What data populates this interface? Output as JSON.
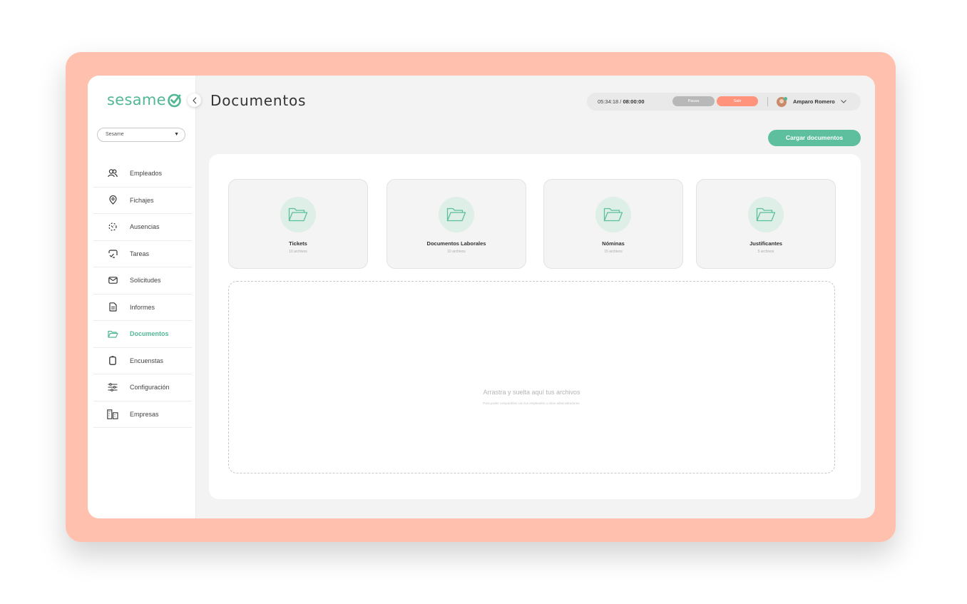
{
  "app": {
    "logo_text": "sesame",
    "brand_color": "#52b894",
    "frame_color": "#ffc0ad"
  },
  "sidebar": {
    "company_select": {
      "value": "Sesame"
    },
    "items": [
      {
        "label": "Empleados",
        "icon": "users-icon",
        "active": false
      },
      {
        "label": "Fichajes",
        "icon": "location-pin-icon",
        "active": false
      },
      {
        "label": "Ausencias",
        "icon": "absence-icon",
        "active": false
      },
      {
        "label": "Tareas",
        "icon": "tasks-icon",
        "active": false
      },
      {
        "label": "Solicitudes",
        "icon": "envelope-icon",
        "active": false
      },
      {
        "label": "Informes",
        "icon": "document-icon",
        "active": false
      },
      {
        "label": "Documentos",
        "icon": "folder-icon",
        "active": true
      },
      {
        "label": "Encuenstas",
        "icon": "clipboard-icon",
        "active": false
      },
      {
        "label": "Configuración",
        "icon": "sliders-icon",
        "active": false
      },
      {
        "label": "Empresas",
        "icon": "buildings-icon",
        "active": false
      }
    ]
  },
  "header": {
    "title": "Documentos",
    "time_elapsed": "05:34:18",
    "time_separator": " / ",
    "time_total": "08:00:00",
    "pause_label": "Pausa",
    "exit_label": "Salir",
    "user_name": "Amparo Romero"
  },
  "main": {
    "upload_button": "Cargar documentos",
    "folders": [
      {
        "name": "Tickets",
        "count": "10 archivos"
      },
      {
        "name": "Documentos Laborales",
        "count": "10 archivos"
      },
      {
        "name": "Nóminas",
        "count": "15 archivos"
      },
      {
        "name": "Justificantes",
        "count": "5 archivos"
      }
    ],
    "dropzone": {
      "title": "Arrastra y suelta aquí tus archivos",
      "subtitle": "Para poder compartirlos con tus empleados u otros administradores."
    }
  }
}
